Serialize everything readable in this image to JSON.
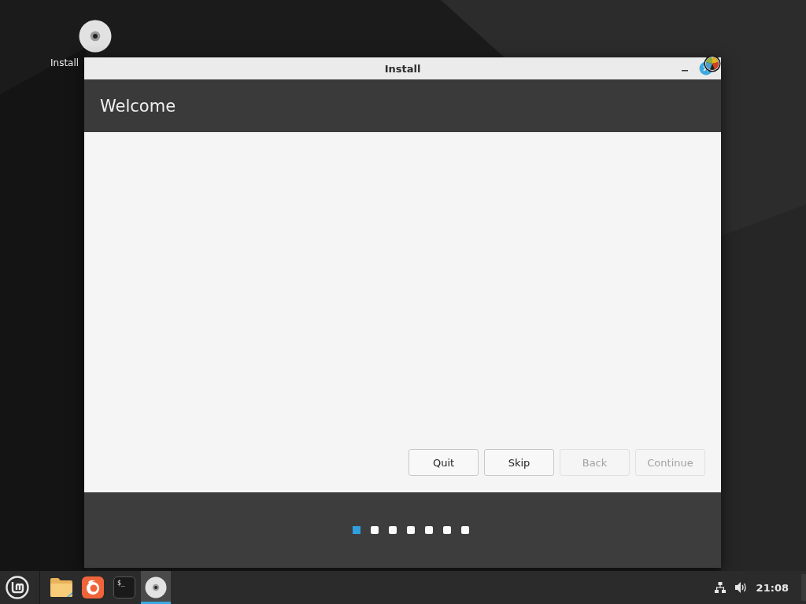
{
  "desktop_icons": [
    {
      "label": "Install"
    }
  ],
  "window": {
    "title": "Install",
    "header": "Welcome",
    "buttons": [
      {
        "label": "Quit",
        "disabled": false
      },
      {
        "label": "Skip",
        "disabled": false
      },
      {
        "label": "Back",
        "disabled": true
      },
      {
        "label": "Continue",
        "disabled": true
      }
    ],
    "steps": [
      {
        "selected": true
      },
      {
        "selected": false
      },
      {
        "selected": false
      },
      {
        "selected": false
      },
      {
        "selected": false
      },
      {
        "selected": false
      },
      {
        "selected": false
      }
    ]
  },
  "taskbar": {
    "launchers": [
      {
        "kind": "folder",
        "active": false
      },
      {
        "kind": "browser",
        "active": false
      },
      {
        "kind": "terminal",
        "active": false,
        "text": "$_"
      },
      {
        "kind": "disc",
        "active": true
      }
    ],
    "clock": "21:08"
  }
}
